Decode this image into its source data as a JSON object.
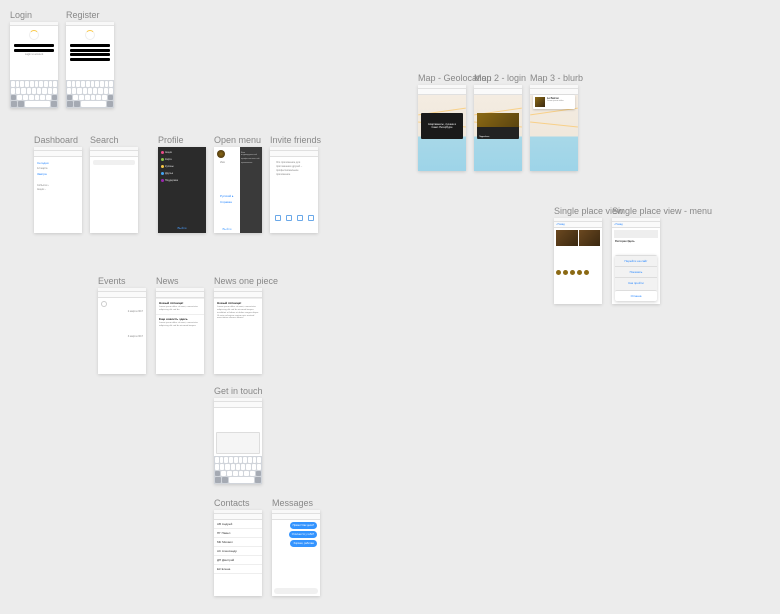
{
  "screens": {
    "login": {
      "label": "Login",
      "footer": "Login to account"
    },
    "register": {
      "label": "Register"
    },
    "dashboard": {
      "label": "Dashboard"
    },
    "search": {
      "label": "Search"
    },
    "profile": {
      "label": "Profile",
      "items": [
        "Акции",
        "Карта",
        "Купоны",
        "Друзья",
        "Поддержка"
      ],
      "logout": "Выйти"
    },
    "open_menu": {
      "label": "Open menu",
      "text_lines": [
        "Ваш индивидуальный",
        "профессиональный",
        "приложение"
      ]
    },
    "invite": {
      "label": "Invite friends",
      "text_lines": [
        "Это приложение для",
        "приглашения друзей –",
        "профессиональное",
        "приложение"
      ]
    },
    "events": {
      "label": "Events",
      "dates": [
        "2 марта 2017",
        "3 марта 2017"
      ]
    },
    "news": {
      "label": "News",
      "items": [
        {
          "title": "Новый пятница!",
          "body": "Lorem ipsum dolor sit amet, consectetur adipiscing elit sed do."
        },
        {
          "title": "Еще новость здесь",
          "body": "Lorem ipsum dolor sit amet, consectetur adipiscing elit sed do eiusmod tempor."
        }
      ]
    },
    "news_one": {
      "label": "News one piece",
      "item": {
        "title": "Новый пятница!",
        "body": "Lorem ipsum dolor sit amet, consectetur adipiscing elit sed do eiusmod tempor incididunt ut labore et dolore magna aliqua. Ut enim ad minim veniam quis nostrud exercitation ullamco laboris."
      }
    },
    "touch": {
      "label": "Get in touch"
    },
    "contacts": {
      "label": "Contacts",
      "items": [
        "АВ Андрей",
        "ПГ Павел",
        "МК Михаил",
        "АС Александр",
        "ДП Дмитрий",
        "ЕК Елена"
      ]
    },
    "messages": {
      "label": "Messages",
      "chat": [
        "Привет! Как дела?",
        "Отлично! А у тебя?",
        "Хорошо, работаю"
      ]
    },
    "map1": {
      "label": "Map - Geolocation",
      "card_title": "Апартаменты, лучшие в",
      "card_sub": "Санкт-Петербурге"
    },
    "map2": {
      "label": "Map 2 - login"
    },
    "map3": {
      "label": "Map 3 - blurb"
    },
    "place1": {
      "label": "Single place view",
      "back": "Назад"
    },
    "place2": {
      "label": "Single place view - menu",
      "back": "Назад",
      "title": "Ресторан Здесь",
      "menu_items": [
        "Перейти на сайт",
        "Показать",
        "Как пройти"
      ],
      "cancel": "Отмена"
    }
  }
}
